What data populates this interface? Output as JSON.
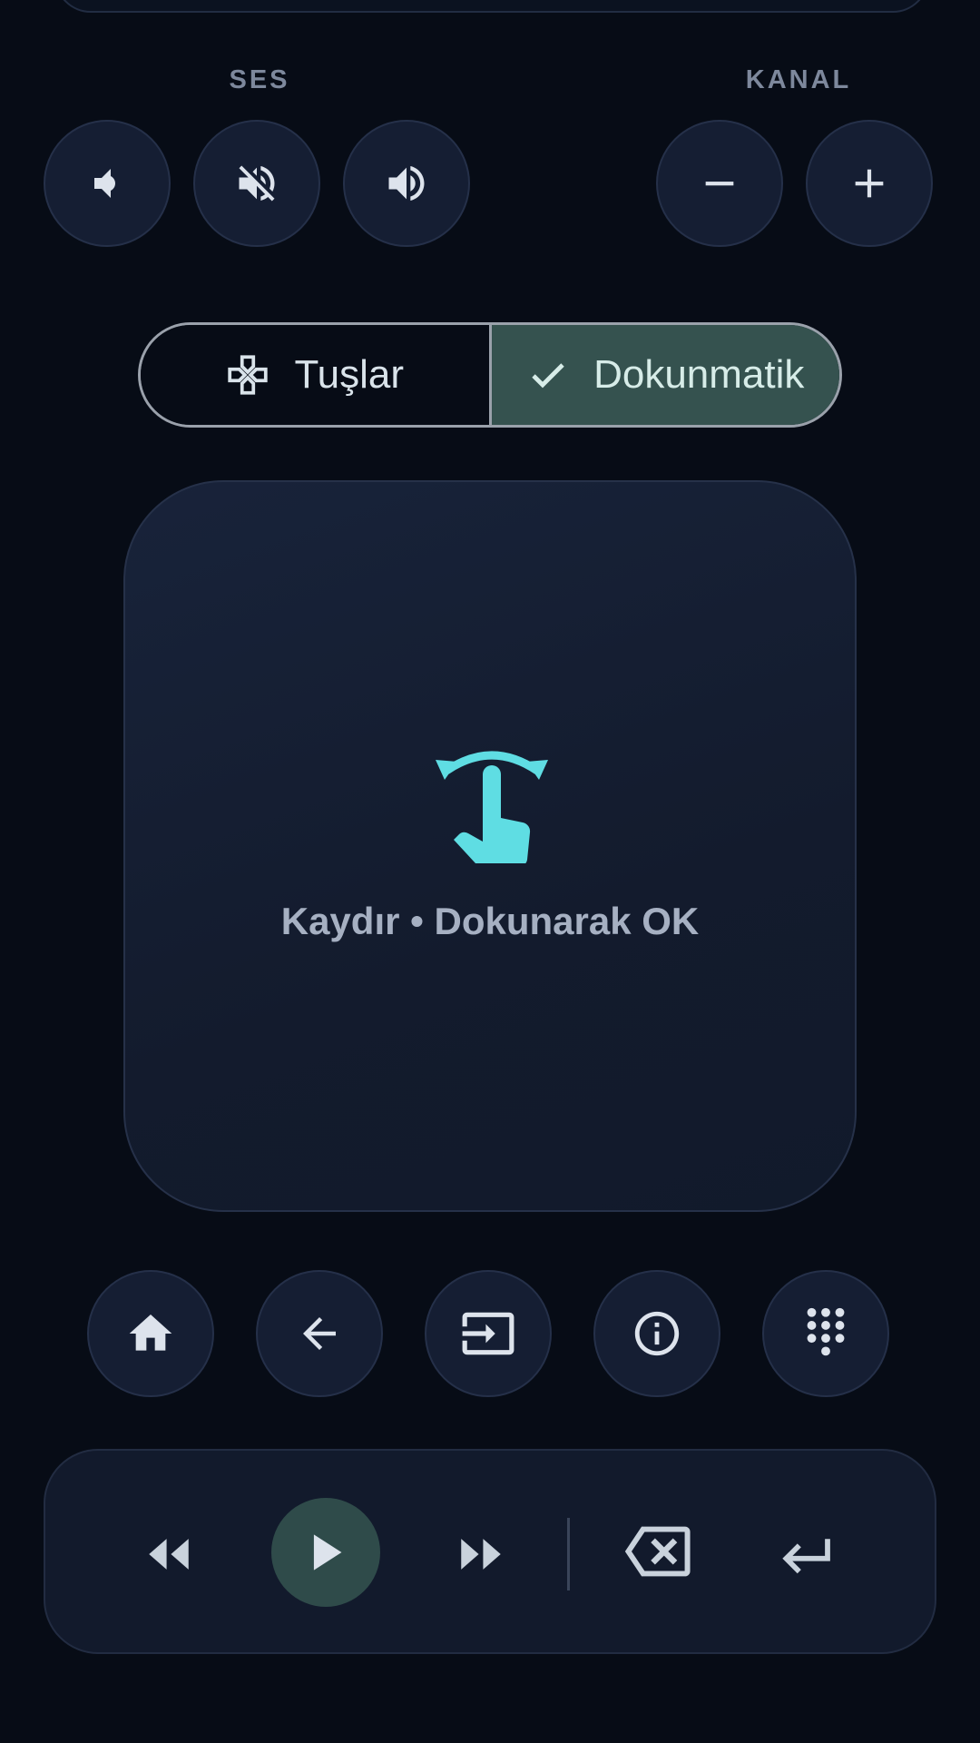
{
  "volume": {
    "label": "SES",
    "buttons": [
      {
        "name": "volume-down",
        "icon": "volume-down-icon"
      },
      {
        "name": "mute",
        "icon": "volume-mute-icon"
      },
      {
        "name": "volume-up",
        "icon": "volume-up-icon"
      }
    ]
  },
  "channel": {
    "label": "KANAL",
    "buttons": [
      {
        "name": "channel-down",
        "icon": "minus-icon"
      },
      {
        "name": "channel-up",
        "icon": "plus-icon"
      }
    ]
  },
  "mode_toggle": {
    "keys_label": "Tuşlar",
    "touch_label": "Dokunmatik",
    "selected": "Dokunmatik",
    "keys_icon": "gamepad-icon",
    "touch_icon": "check-icon"
  },
  "touchpad": {
    "hint": "Kaydır • Dokunarak OK",
    "icon": "swipe-gesture-icon",
    "accent": "#5fdde3"
  },
  "nav_buttons": [
    {
      "name": "home",
      "icon": "home-icon"
    },
    {
      "name": "back",
      "icon": "arrow-back-icon"
    },
    {
      "name": "input",
      "icon": "input-source-icon"
    },
    {
      "name": "info",
      "icon": "info-icon"
    },
    {
      "name": "keypad",
      "icon": "dialpad-icon"
    }
  ],
  "media": {
    "controls": [
      {
        "name": "rewind",
        "icon": "rewind-icon"
      },
      {
        "name": "play",
        "icon": "play-icon"
      },
      {
        "name": "fast-forward",
        "icon": "fast-forward-icon"
      },
      {
        "name": "delete",
        "icon": "backspace-icon"
      },
      {
        "name": "enter",
        "icon": "enter-icon"
      }
    ]
  },
  "colors": {
    "background": "#070c16",
    "button_fill": "#151e33",
    "selected_fill": "#35524f",
    "label_gray": "#7d889c"
  }
}
